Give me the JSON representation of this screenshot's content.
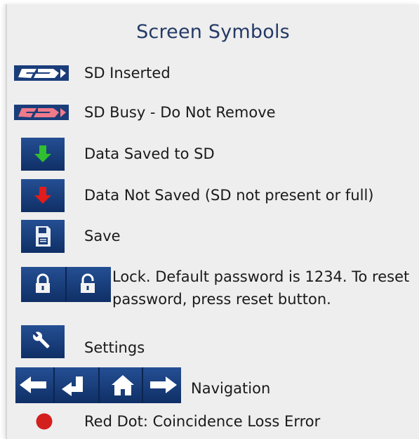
{
  "title": "Screen Symbols",
  "items": [
    {
      "icon": "sd-card-white-icon",
      "label": "SD Inserted"
    },
    {
      "icon": "sd-card-red-icon",
      "label": "SD Busy - Do Not Remove"
    },
    {
      "icon": "arrow-down-green-icon",
      "label": "Data Saved to SD"
    },
    {
      "icon": "arrow-down-red-icon",
      "label": "Data Not Saved (SD not present or full)"
    },
    {
      "icon": "floppy-disk-icon",
      "label": "Save"
    },
    {
      "icon": "padlock-icons",
      "label": "Lock. Default password is 1234. To reset password, press reset button."
    },
    {
      "icon": "wrench-icon",
      "label": "Settings"
    },
    {
      "icon": "navigation-icons",
      "label": "Navigation"
    },
    {
      "icon": "red-dot-icon",
      "label": "Red Dot: Coincidence Loss Error"
    }
  ],
  "colors": {
    "title": "#233a66",
    "icon_blue": "#1a3d7a",
    "green_arrow": "#2fbf2f",
    "red_arrow": "#e21b1b",
    "red_dot": "#d41f1f",
    "panel_bg": "#eeeeee"
  }
}
